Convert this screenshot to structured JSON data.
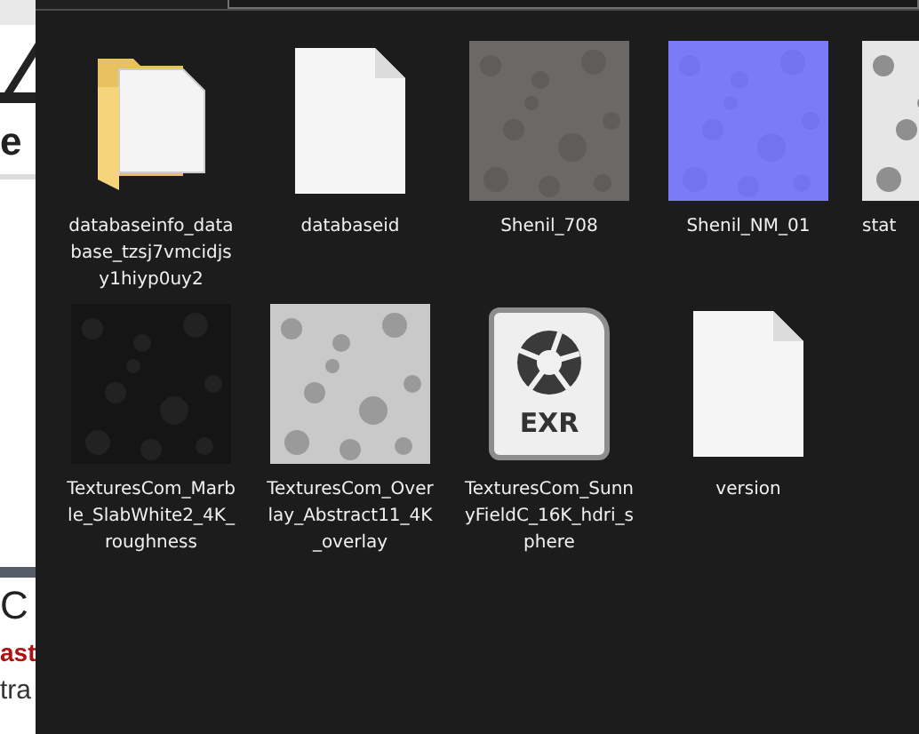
{
  "background_page": {
    "heading_fragment": "e",
    "title_fragment": "C",
    "link_fragment": "ast",
    "text_fragment": "tra"
  },
  "items": [
    {
      "kind": "folder",
      "name": "databaseinfo_database_tzsj7vmcidjsy1hiyp0uy2"
    },
    {
      "kind": "file",
      "name": "databaseid"
    },
    {
      "kind": "picture",
      "name": "Shenil_708"
    },
    {
      "kind": "picture",
      "name": "Shenil_NM_01"
    },
    {
      "kind": "picture",
      "name": "stat"
    },
    {
      "kind": "picture",
      "name": "TexturesCom_Marble_SlabWhite2_4K_roughness"
    },
    {
      "kind": "picture",
      "name": "TexturesCom_Overlay_Abstract11_4K_overlay"
    },
    {
      "kind": "exr",
      "name": "TexturesCom_SunnyFieldC_16K_hdri_sphere",
      "badge": "EXR"
    },
    {
      "kind": "file",
      "name": "version"
    }
  ]
}
